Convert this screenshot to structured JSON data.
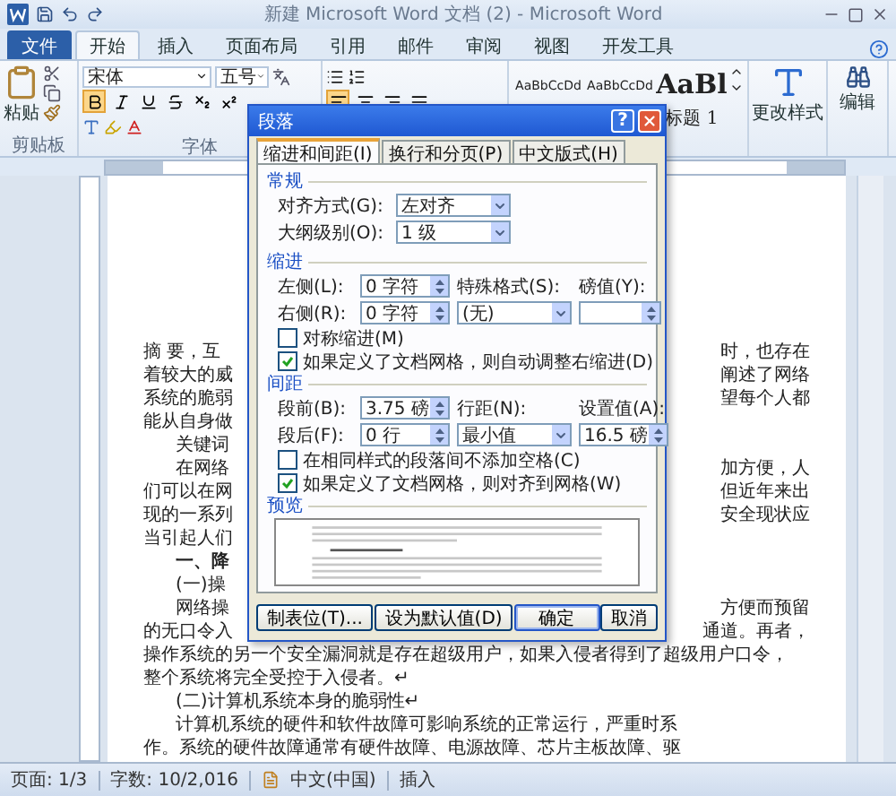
{
  "window": {
    "title": "新建 Microsoft Word 文档 (2) - Microsoft Word"
  },
  "ribbon_tabs": [
    {
      "label": "文件",
      "kind": "file",
      "selected": false
    },
    {
      "label": "开始",
      "kind": "tab",
      "selected": true
    },
    {
      "label": "插入",
      "kind": "tab",
      "selected": false
    },
    {
      "label": "页面布局",
      "kind": "tab",
      "selected": false
    },
    {
      "label": "引用",
      "kind": "tab",
      "selected": false
    },
    {
      "label": "邮件",
      "kind": "tab",
      "selected": false
    },
    {
      "label": "审阅",
      "kind": "tab",
      "selected": false
    },
    {
      "label": "视图",
      "kind": "tab",
      "selected": false
    },
    {
      "label": "开发工具",
      "kind": "tab",
      "selected": false
    }
  ],
  "ribbon": {
    "paste": "粘贴",
    "font_name": "宋体",
    "font_size": "五号",
    "format_buttons": [
      {
        "kind": "bold",
        "on": true
      },
      {
        "kind": "italic",
        "on": false
      },
      {
        "kind": "underline",
        "on": false
      },
      {
        "kind": "strike",
        "on": false
      },
      {
        "kind": "subscript",
        "on": false
      },
      {
        "kind": "superscript",
        "on": false
      }
    ],
    "align_buttons": [
      {
        "kind": "left",
        "on": true
      },
      {
        "kind": "center",
        "on": false
      },
      {
        "kind": "right",
        "on": false
      },
      {
        "kind": "justify",
        "on": false
      }
    ],
    "styles": [
      {
        "sample": "AaBbCcDd",
        "kind": "small"
      },
      {
        "sample": "AaBbCcDd",
        "kind": "small"
      },
      {
        "sample": "AaBl",
        "kind": "large",
        "label": "标题 1"
      }
    ],
    "change_styles": "更改样式",
    "editing": "编辑",
    "group_labels": [
      "剪贴板",
      "字体"
    ]
  },
  "dialog": {
    "title": "段落",
    "help": "?",
    "tabs": [
      {
        "label": "缩进和间距(I)",
        "selected": true
      },
      {
        "label": "换行和分页(P)",
        "selected": false
      },
      {
        "label": "中文版式(H)",
        "selected": false
      }
    ],
    "general": {
      "heading": "常规",
      "alignment": {
        "label": "对齐方式(G):",
        "value": "左对齐"
      },
      "outline": {
        "label": "大纲级别(O):",
        "value": "1 级"
      }
    },
    "indent": {
      "heading": "缩进",
      "left": {
        "label": "左侧(L):",
        "value": "0 字符"
      },
      "right": {
        "label": "右侧(R):",
        "value": "0 字符"
      },
      "special": {
        "label": "特殊格式(S):",
        "value": "(无)"
      },
      "by": {
        "label": "磅值(Y):"
      },
      "checks": [
        {
          "label": "对称缩进(M)",
          "checked": false
        },
        {
          "label": "如果定义了文档网格，则自动调整右缩进(D)",
          "checked": true
        }
      ]
    },
    "spacing": {
      "heading": "间距",
      "before": {
        "label": "段前(B):",
        "value": "3.75 磅"
      },
      "after": {
        "label": "段后(F):",
        "value": "0 行"
      },
      "line": {
        "label": "行距(N):",
        "value": "最小值"
      },
      "at": {
        "label": "设置值(A):",
        "value": "16.5 磅"
      },
      "checks": [
        {
          "label": "在相同样式的段落间不添加空格(C)",
          "checked": false
        },
        {
          "label": "如果定义了文档网格，则对齐到网格(W)",
          "checked": true
        }
      ]
    },
    "preview": {
      "heading": "预览"
    },
    "buttons": [
      {
        "label": "制表位(T)...",
        "default": false
      },
      {
        "label": "设为默认值(D)",
        "default": false
      },
      {
        "label": "确定",
        "default": true
      },
      {
        "label": "取消",
        "default": false
      }
    ]
  },
  "document": {
    "lines": [
      {
        "left": "摘 要，互",
        "right": "时，也存在",
        "indented": false,
        "bold": false
      },
      {
        "left": "着较大的威",
        "right": "阐述了网络",
        "indented": false,
        "bold": false
      },
      {
        "left": "系统的脆弱",
        "right": "望每个人都",
        "indented": false,
        "bold": false
      },
      {
        "left": "能从自身做",
        "indented": false,
        "bold": false
      },
      {
        "left": "关键词",
        "indented": true,
        "bold": false
      },
      {
        "left": "在网络",
        "right": "加方便，人",
        "indented": true,
        "bold": false
      },
      {
        "left": "们可以在网",
        "right": "但近年来出",
        "indented": false,
        "bold": false
      },
      {
        "left": "现的一系列",
        "right": "安全现状应",
        "indented": false,
        "bold": false
      },
      {
        "left": "当引起人们",
        "indented": false,
        "bold": false
      },
      {
        "left": "一、降",
        "indented": true,
        "bold": true
      },
      {
        "left": "(一)操",
        "indented": true,
        "bold": false
      },
      {
        "left": "网络操",
        "right": "方便而预留",
        "indented": true,
        "bold": false
      },
      {
        "left": "的无口令入",
        "right": "通道。再者，",
        "indented": false,
        "bold": false
      },
      {
        "text": "操作系统的另一个安全漏洞就是存在超级用户，如果入侵者得到了超级用户口令，",
        "indented": false,
        "bold": false
      },
      {
        "text": "整个系统将完全受控于入侵者。↵",
        "indented": false,
        "bold": false
      },
      {
        "text": "(二)计算机系统本身的脆弱性↵",
        "indented": true,
        "bold": false
      },
      {
        "text": "计算机系统的硬件和软件故障可影响系统的正常运行，严重时系",
        "indented": true,
        "bold": false
      },
      {
        "text": "作。系统的硬件故障通常有硬件故障、电源故障、芯片主板故障、驱",
        "indented": false,
        "bold": false
      }
    ]
  },
  "status_bar": {
    "items": [
      "页面: 1/3",
      "字数: 10/2,016",
      "中文(中国)",
      "插入"
    ]
  }
}
